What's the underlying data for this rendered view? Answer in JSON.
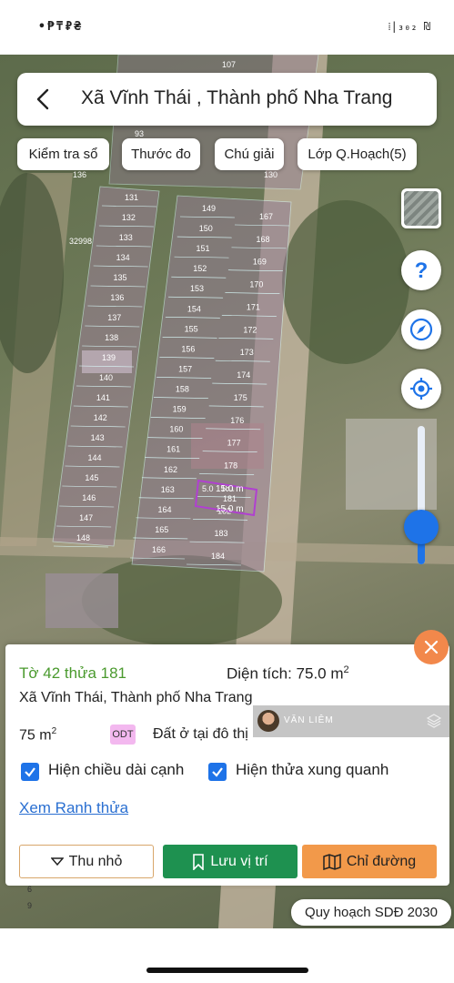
{
  "status_bar": {
    "left": "•₱₸₽₴",
    "right": "⁞|₃₀₂ ₪"
  },
  "header": {
    "title": "Xã Vĩnh Thái , Thành phố Nha Trang"
  },
  "chips": [
    "Kiểm tra sổ",
    "Thước đo",
    "Chú giải",
    "Lớp Q.Hoạch(5)"
  ],
  "map": {
    "top_labels": [
      "107",
      "93",
      "136",
      "130",
      "32998"
    ],
    "left_block": [
      "131",
      "132",
      "133",
      "134",
      "135",
      "136",
      "137",
      "138",
      "139",
      "140",
      "141",
      "142",
      "143",
      "144",
      "145",
      "146",
      "147",
      "148"
    ],
    "mid_col_a": [
      "149",
      "150",
      "151",
      "152",
      "153",
      "154",
      "155",
      "156",
      "157",
      "158",
      "159",
      "160",
      "161",
      "162",
      "163",
      "164",
      "165",
      "166"
    ],
    "mid_col_b": [
      "167",
      "168",
      "169",
      "170",
      "171",
      "172",
      "173",
      "174",
      "175",
      "176",
      "177",
      "178",
      "181",
      "182",
      "183",
      "184"
    ],
    "selected_parcel": {
      "id": "181",
      "edge_top": "15.0 m",
      "edge_bottom": "15.0 m",
      "edge_side": "5.0"
    },
    "bottom_labels": [
      "6",
      "9"
    ]
  },
  "controls": {
    "layer_icon": "layers-icon",
    "help_icon": "question-icon",
    "compass_icon": "compass-icon",
    "locate_icon": "locate-icon",
    "zoom_level": 0.25
  },
  "panel": {
    "parcel_id": "Tờ 42 thửa 181",
    "area_label": "Diện tích: 75.0 m",
    "area_sup": "2",
    "address": "Xã Vĩnh Thái, Thành phố Nha Trang",
    "size_value": "75 m",
    "size_sup": "2",
    "land_code": "ODT",
    "land_type": "Đất ở tại đô thị",
    "checkbox_edges": "Hiện chiều dài cạnh",
    "checkbox_neighbors": "Hiện thửa xung quanh",
    "view_boundary_link": "Xem Ranh thửa",
    "collapse_button": "Thu nhỏ",
    "save_button": "Lưu vị trí",
    "route_button": "Chỉ đường"
  },
  "watermark": {
    "name": "VĂN LIÊM"
  },
  "plan_label": "Quy hoạch SDĐ 2030",
  "colors": {
    "accent_blue": "#1e73e8",
    "green_button": "#1e9150",
    "orange_button": "#f2994a",
    "close_orange": "#f2884b",
    "parcel_green_text": "#4a9a2e",
    "odt_pink": "#f3b8ef",
    "selected_outline": "#b040d0"
  }
}
